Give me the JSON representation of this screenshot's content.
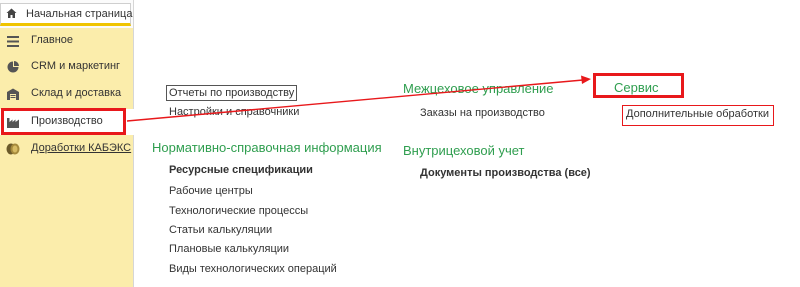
{
  "tabs": {
    "home_label": "Начальная страница"
  },
  "sidebar": {
    "items": [
      {
        "label": "Главное",
        "icon": "menu-lines-icon"
      },
      {
        "label": "CRM и маркетинг",
        "icon": "pie-chart-icon"
      },
      {
        "label": "Склад и доставка",
        "icon": "warehouse-icon"
      },
      {
        "label": "Производство",
        "icon": "factory-icon",
        "selected": true
      },
      {
        "label": "Доработки КАБЭКС",
        "icon": "coins-icon"
      }
    ]
  },
  "main": {
    "top_links": [
      "Отчеты по производству",
      "Настройки и справочники"
    ],
    "nsi": {
      "title": "Нормативно-справочная информация",
      "items": [
        "Ресурсные спецификации",
        "Рабочие центры",
        "Технологические процессы",
        "Статьи калькуляции",
        "Плановые калькуляции",
        "Виды технологических операций"
      ]
    },
    "inter_shop": {
      "title": "Межцеховое управление",
      "items": [
        "Заказы на производство"
      ]
    },
    "intra_shop": {
      "title": "Внутрицеховой учет",
      "items": [
        "Документы производства (все)"
      ]
    },
    "service": {
      "title": "Сервис",
      "items": [
        "Дополнительные обработки"
      ]
    }
  },
  "colors": {
    "accent_green": "#2f9e4f",
    "sidebar_bg": "#fbedab",
    "annotation_red": "#e8181b",
    "tab_underline": "#f0c400"
  }
}
